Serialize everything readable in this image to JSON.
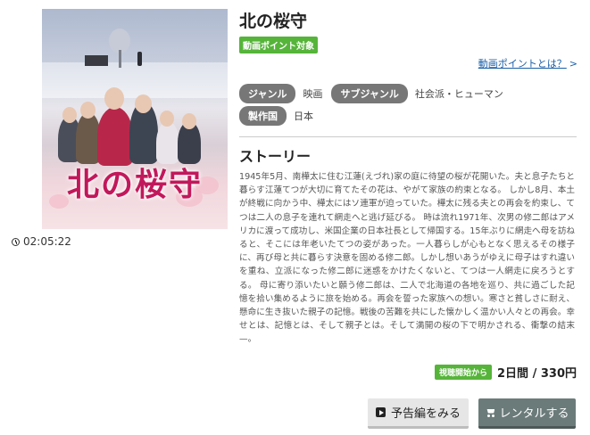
{
  "poster": {
    "title": "北の桜守"
  },
  "duration": "02:05:22",
  "title": "北の桜守",
  "point_badge": "動画ポイント対象",
  "point_link": {
    "label": "動画ポイントとは？",
    "chevron": ">"
  },
  "meta": [
    {
      "tag": "ジャンル",
      "value": "映画"
    },
    {
      "tag": "サブジャンル",
      "value": "社会派・ヒューマン"
    },
    {
      "tag": "製作国",
      "value": "日本"
    }
  ],
  "story": {
    "heading": "ストーリー",
    "text": "1945年5月、南樺太に住む江蓮(えづれ)家の庭に待望の桜が花開いた。夫と息子たちと暮らす江蓮てつが大切に育てたその花は、やがて家族の約束となる。 しかし8月、本土が終戦に向かう中、樺太にはソ連軍が迫っていた。樺太に残る夫との再会を約束し、てつは二人の息子を連れて網走へと逃げ延びる。 時は流れ1971年、次男の修二郎はアメリカに渡って成功し、米国企業の日本社長として帰国する。15年ぶりに網走へ母を訪ねると、そこには年老いたてつの姿があった。一人暮らしが心もとなく思えるその様子に、再び母と共に暮らす決意を固める修二郎。しかし想いあうがゆえに母子はすれ違いを重ね、立派になった修二郎に迷惑をかけたくないと、てつは一人網走に戻ろうとする。 母に寄り添いたいと願う修二郎は、二人で北海道の各地を巡り、共に過ごした記憶を拾い集めるように旅を始める。再会を誓った家族への想い。寒さと貧しさに耐え、懸命に生き抜いた親子の記憶。戦後の苦難を共にした懐かしく温かい人々との再会。幸せとは、記憶とは、そして親子とは。そして満開の桜の下で明かされる、衝撃の結末—。"
  },
  "price": {
    "badge": "視聴開始から",
    "text": "2日間 / 330円"
  },
  "buttons": {
    "trailer": "予告編をみる",
    "rent": "レンタルする"
  },
  "colors": {
    "accent_green": "#56b43a",
    "link_blue": "#1a5fa8",
    "tag_gray": "#777777",
    "rent_button": "#6b7b7a"
  }
}
